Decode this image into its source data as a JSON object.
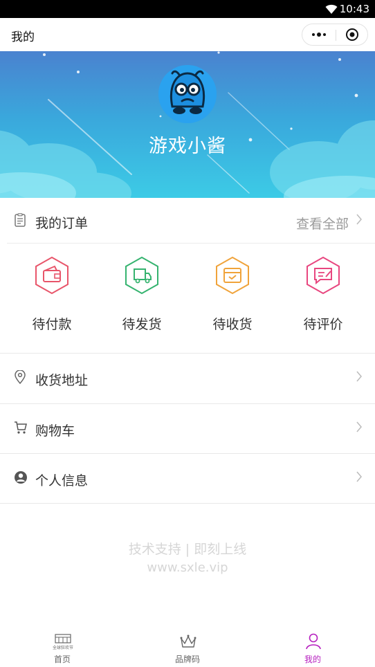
{
  "status_bar": {
    "time": "10:43"
  },
  "nav": {
    "title": "我的"
  },
  "profile": {
    "username": "游戏小酱"
  },
  "orders": {
    "title": "我的订单",
    "view_all": "查看全部",
    "items": [
      {
        "label": "待付款",
        "icon": "wallet-icon",
        "color": "#e8556a"
      },
      {
        "label": "待发货",
        "icon": "truck-icon",
        "color": "#35b36f"
      },
      {
        "label": "待收货",
        "icon": "box-icon",
        "color": "#f0a33a"
      },
      {
        "label": "待评价",
        "icon": "review-icon",
        "color": "#e8467f"
      }
    ]
  },
  "menu": [
    {
      "label": "收货地址",
      "icon": "location-pin-icon"
    },
    {
      "label": "购物车",
      "icon": "cart-icon"
    },
    {
      "label": "个人信息",
      "icon": "user-icon"
    }
  ],
  "footer": {
    "line1": "技术支持 | 即刻上线",
    "line2": "www.sxle.vip"
  },
  "tabs": [
    {
      "label": "首页",
      "icon": "home-icon",
      "icon_text": "全球狂欢节"
    },
    {
      "label": "品牌码",
      "icon": "crown-icon"
    },
    {
      "label": "我的",
      "icon": "person-icon",
      "active": true
    }
  ],
  "colors": {
    "accent": "#b61fbf",
    "banner_top": "#4a82cf",
    "banner_bottom": "#3ccbe6"
  }
}
